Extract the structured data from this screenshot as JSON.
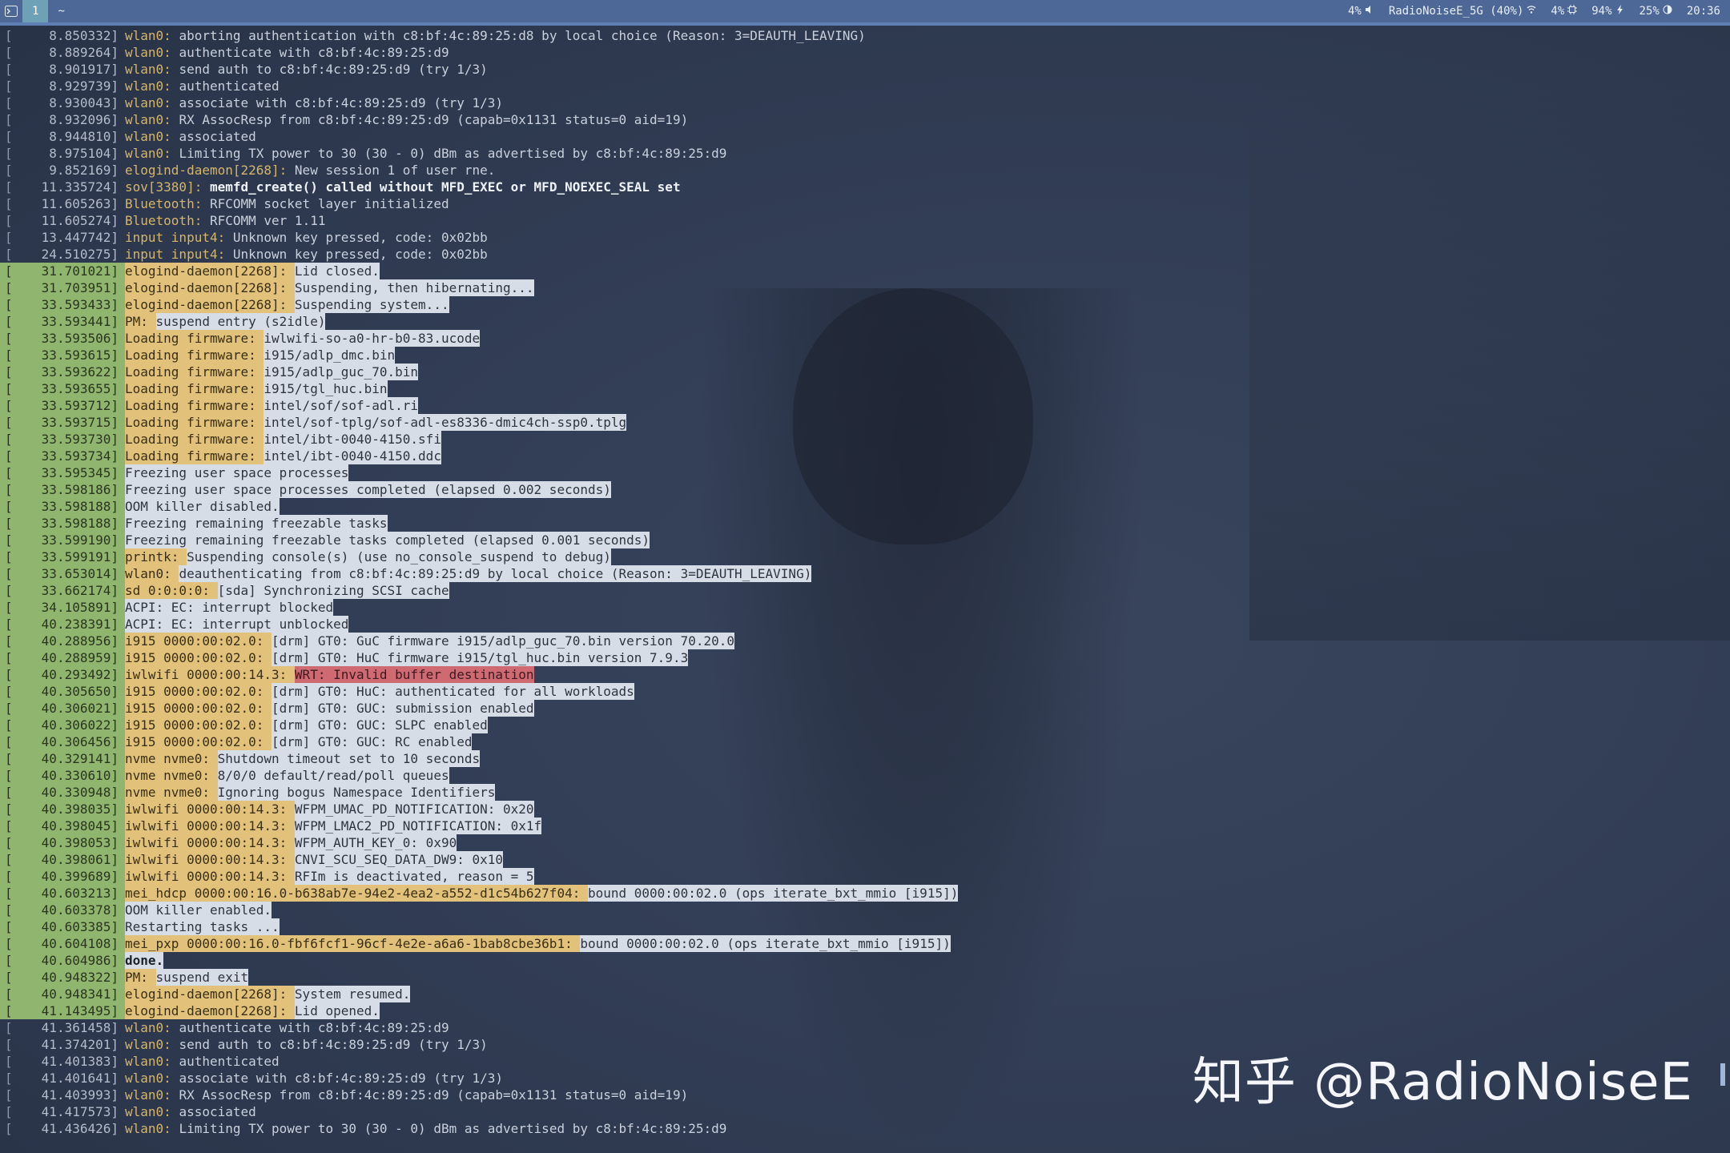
{
  "topbar": {
    "app_icon": "terminal-icon",
    "workspace": "1",
    "tab": "~",
    "status": [
      {
        "text": "4%",
        "icon": "volume-icon"
      },
      {
        "text": "RadioNoiseE_5G (40%)",
        "icon": "wifi-icon"
      },
      {
        "text": "4%",
        "icon": "cpu-icon"
      },
      {
        "text": "94%",
        "icon": "battery-charging-icon"
      },
      {
        "text": "25%",
        "icon": "brightness-icon"
      },
      {
        "text": "20:36",
        "icon": ""
      }
    ]
  },
  "colors": {
    "accent": "#4d6796",
    "highlight_ts": "#8fb56e",
    "highlight_src": "#e2c27a",
    "highlight_msg": "#d7dde6",
    "error": "#d06a72"
  },
  "log": [
    {
      "ts": "8.850332]",
      "src": "wlan0:",
      "msg": "aborting authentication with c8:bf:4c:89:25:d8 by local choice (Reason: 3=DEAUTH_LEAVING)",
      "hl": false
    },
    {
      "ts": "8.889264]",
      "src": "wlan0:",
      "msg": "authenticate with c8:bf:4c:89:25:d9",
      "hl": false
    },
    {
      "ts": "8.901917]",
      "src": "wlan0:",
      "msg": "send auth to c8:bf:4c:89:25:d9 (try 1/3)",
      "hl": false
    },
    {
      "ts": "8.929739]",
      "src": "wlan0:",
      "msg": "authenticated",
      "hl": false
    },
    {
      "ts": "8.930043]",
      "src": "wlan0:",
      "msg": "associate with c8:bf:4c:89:25:d9 (try 1/3)",
      "hl": false
    },
    {
      "ts": "8.932096]",
      "src": "wlan0:",
      "msg": "RX AssocResp from c8:bf:4c:89:25:d9 (capab=0x1131 status=0 aid=19)",
      "hl": false
    },
    {
      "ts": "8.944810]",
      "src": "wlan0:",
      "msg": "associated",
      "hl": false
    },
    {
      "ts": "8.975104]",
      "src": "wlan0:",
      "msg": "Limiting TX power to 30 (30 - 0) dBm as advertised by c8:bf:4c:89:25:d9",
      "hl": false
    },
    {
      "ts": "9.852169]",
      "src": "elogind-daemon[2268]:",
      "msg": "New session 1 of user rne.",
      "hl": false
    },
    {
      "ts": "11.335724]",
      "src": "sov[3380]:",
      "msg": "memfd_create() called without MFD_EXEC or MFD_NOEXEC_SEAL set",
      "hl": false,
      "bold": true
    },
    {
      "ts": "11.605263]",
      "src": "Bluetooth:",
      "msg": "RFCOMM socket layer initialized",
      "hl": false
    },
    {
      "ts": "11.605274]",
      "src": "Bluetooth:",
      "msg": "RFCOMM ver 1.11",
      "hl": false
    },
    {
      "ts": "13.447742]",
      "src": "input input4:",
      "msg": "Unknown key pressed, code: 0x02bb",
      "hl": false
    },
    {
      "ts": "24.510275]",
      "src": "input input4:",
      "msg": "Unknown key pressed, code: 0x02bb",
      "hl": false
    },
    {
      "ts": "31.701021]",
      "src": "elogind-daemon[2268]:",
      "msg": "Lid closed.",
      "hl": true
    },
    {
      "ts": "31.703951]",
      "src": "elogind-daemon[2268]:",
      "msg": "Suspending, then hibernating...",
      "hl": true
    },
    {
      "ts": "33.593433]",
      "src": "elogind-daemon[2268]:",
      "msg": "Suspending system...",
      "hl": true
    },
    {
      "ts": "33.593441]",
      "src": "PM:",
      "msg": "suspend entry (s2idle)",
      "hl": true
    },
    {
      "ts": "33.593506]",
      "src": "Loading firmware:",
      "msg": "iwlwifi-so-a0-hr-b0-83.ucode",
      "hl": true
    },
    {
      "ts": "33.593615]",
      "src": "Loading firmware:",
      "msg": "i915/adlp_dmc.bin",
      "hl": true
    },
    {
      "ts": "33.593622]",
      "src": "Loading firmware:",
      "msg": "i915/adlp_guc_70.bin",
      "hl": true
    },
    {
      "ts": "33.593655]",
      "src": "Loading firmware:",
      "msg": "i915/tgl_huc.bin",
      "hl": true
    },
    {
      "ts": "33.593712]",
      "src": "Loading firmware:",
      "msg": "intel/sof/sof-adl.ri",
      "hl": true
    },
    {
      "ts": "33.593715]",
      "src": "Loading firmware:",
      "msg": "intel/sof-tplg/sof-adl-es8336-dmic4ch-ssp0.tplg",
      "hl": true
    },
    {
      "ts": "33.593730]",
      "src": "Loading firmware:",
      "msg": "intel/ibt-0040-4150.sfi",
      "hl": true
    },
    {
      "ts": "33.593734]",
      "src": "Loading firmware:",
      "msg": "intel/ibt-0040-4150.ddc",
      "hl": true
    },
    {
      "ts": "33.595345]",
      "src": "",
      "msg": "Freezing user space processes",
      "hl": true
    },
    {
      "ts": "33.598186]",
      "src": "",
      "msg": "Freezing user space processes completed (elapsed 0.002 seconds)",
      "hl": true
    },
    {
      "ts": "33.598188]",
      "src": "",
      "msg": "OOM killer disabled.",
      "hl": true
    },
    {
      "ts": "33.598188]",
      "src": "",
      "msg": "Freezing remaining freezable tasks",
      "hl": true
    },
    {
      "ts": "33.599190]",
      "src": "",
      "msg": "Freezing remaining freezable tasks completed (elapsed 0.001 seconds)",
      "hl": true
    },
    {
      "ts": "33.599191]",
      "src": "printk:",
      "msg": "Suspending console(s) (use no_console_suspend to debug)",
      "hl": true
    },
    {
      "ts": "33.653014]",
      "src": "wlan0:",
      "msg": "deauthenticating from c8:bf:4c:89:25:d9 by local choice (Reason: 3=DEAUTH_LEAVING)",
      "hl": true
    },
    {
      "ts": "33.662174]",
      "src": "sd 0:0:0:0:",
      "msg": "[sda] Synchronizing SCSI cache",
      "hl": true
    },
    {
      "ts": "34.105891]",
      "src": "",
      "msg": "ACPI: EC: interrupt blocked",
      "hl": true
    },
    {
      "ts": "40.238391]",
      "src": "",
      "msg": "ACPI: EC: interrupt unblocked",
      "hl": true
    },
    {
      "ts": "40.288956]",
      "src": "i915 0000:00:02.0:",
      "msg": "[drm] GT0: GuC firmware i915/adlp_guc_70.bin version 70.20.0",
      "hl": true
    },
    {
      "ts": "40.288959]",
      "src": "i915 0000:00:02.0:",
      "msg": "[drm] GT0: HuC firmware i915/tgl_huc.bin version 7.9.3",
      "hl": true
    },
    {
      "ts": "40.293492]",
      "src": "iwlwifi 0000:00:14.3:",
      "msg": "WRT: Invalid buffer destination",
      "hl": true,
      "err": true
    },
    {
      "ts": "40.305650]",
      "src": "i915 0000:00:02.0:",
      "msg": "[drm] GT0: HuC: authenticated for all workloads",
      "hl": true
    },
    {
      "ts": "40.306021]",
      "src": "i915 0000:00:02.0:",
      "msg": "[drm] GT0: GUC: submission enabled",
      "hl": true
    },
    {
      "ts": "40.306022]",
      "src": "i915 0000:00:02.0:",
      "msg": "[drm] GT0: GUC: SLPC enabled",
      "hl": true
    },
    {
      "ts": "40.306456]",
      "src": "i915 0000:00:02.0:",
      "msg": "[drm] GT0: GUC: RC enabled",
      "hl": true
    },
    {
      "ts": "40.329141]",
      "src": "nvme nvme0:",
      "msg": "Shutdown timeout set to 10 seconds",
      "hl": true
    },
    {
      "ts": "40.330610]",
      "src": "nvme nvme0:",
      "msg": "8/0/0 default/read/poll queues",
      "hl": true
    },
    {
      "ts": "40.330948]",
      "src": "nvme nvme0:",
      "msg": "Ignoring bogus Namespace Identifiers",
      "hl": true
    },
    {
      "ts": "40.398035]",
      "src": "iwlwifi 0000:00:14.3:",
      "msg": "WFPM_UMAC_PD_NOTIFICATION: 0x20",
      "hl": true
    },
    {
      "ts": "40.398045]",
      "src": "iwlwifi 0000:00:14.3:",
      "msg": "WFPM_LMAC2_PD_NOTIFICATION: 0x1f",
      "hl": true
    },
    {
      "ts": "40.398053]",
      "src": "iwlwifi 0000:00:14.3:",
      "msg": "WFPM_AUTH_KEY_0: 0x90",
      "hl": true
    },
    {
      "ts": "40.398061]",
      "src": "iwlwifi 0000:00:14.3:",
      "msg": "CNVI_SCU_SEQ_DATA_DW9: 0x10",
      "hl": true
    },
    {
      "ts": "40.399689]",
      "src": "iwlwifi 0000:00:14.3:",
      "msg": "RFIm is deactivated, reason = 5",
      "hl": true
    },
    {
      "ts": "40.603213]",
      "src": "mei_hdcp 0000:00:16.0-b638ab7e-94e2-4ea2-a552-d1c54b627f04:",
      "msg": "bound 0000:00:02.0 (ops iterate_bxt_mmio [i915])",
      "hl": true
    },
    {
      "ts": "40.603378]",
      "src": "",
      "msg": "OOM killer enabled.",
      "hl": true
    },
    {
      "ts": "40.603385]",
      "src": "",
      "msg": "Restarting tasks ...",
      "hl": true
    },
    {
      "ts": "40.604108]",
      "src": "mei_pxp 0000:00:16.0-fbf6fcf1-96cf-4e2e-a6a6-1bab8cbe36b1:",
      "msg": "bound 0000:00:02.0 (ops iterate_bxt_mmio [i915])",
      "hl": true
    },
    {
      "ts": "40.604986]",
      "src": "",
      "msg": "done.",
      "hl": true,
      "bold": true
    },
    {
      "ts": "40.948322]",
      "src": "PM:",
      "msg": "suspend exit",
      "hl": true
    },
    {
      "ts": "40.948341]",
      "src": "elogind-daemon[2268]:",
      "msg": "System resumed.",
      "hl": true
    },
    {
      "ts": "41.143495]",
      "src": "elogind-daemon[2268]:",
      "msg": "Lid opened.",
      "hl": true
    },
    {
      "ts": "41.361458]",
      "src": "wlan0:",
      "msg": "authenticate with c8:bf:4c:89:25:d9",
      "hl": false
    },
    {
      "ts": "41.374201]",
      "src": "wlan0:",
      "msg": "send auth to c8:bf:4c:89:25:d9 (try 1/3)",
      "hl": false
    },
    {
      "ts": "41.401383]",
      "src": "wlan0:",
      "msg": "authenticated",
      "hl": false
    },
    {
      "ts": "41.401641]",
      "src": "wlan0:",
      "msg": "associate with c8:bf:4c:89:25:d9 (try 1/3)",
      "hl": false
    },
    {
      "ts": "41.403993]",
      "src": "wlan0:",
      "msg": "RX AssocResp from c8:bf:4c:89:25:d9 (capab=0x1131 status=0 aid=19)",
      "hl": false
    },
    {
      "ts": "41.417573]",
      "src": "wlan0:",
      "msg": "associated",
      "hl": false
    },
    {
      "ts": "41.436426]",
      "src": "wlan0:",
      "msg": "Limiting TX power to 30 (30 - 0) dBm as advertised by c8:bf:4c:89:25:d9",
      "hl": false
    }
  ],
  "watermark": "知乎 @RadioNoiseE"
}
